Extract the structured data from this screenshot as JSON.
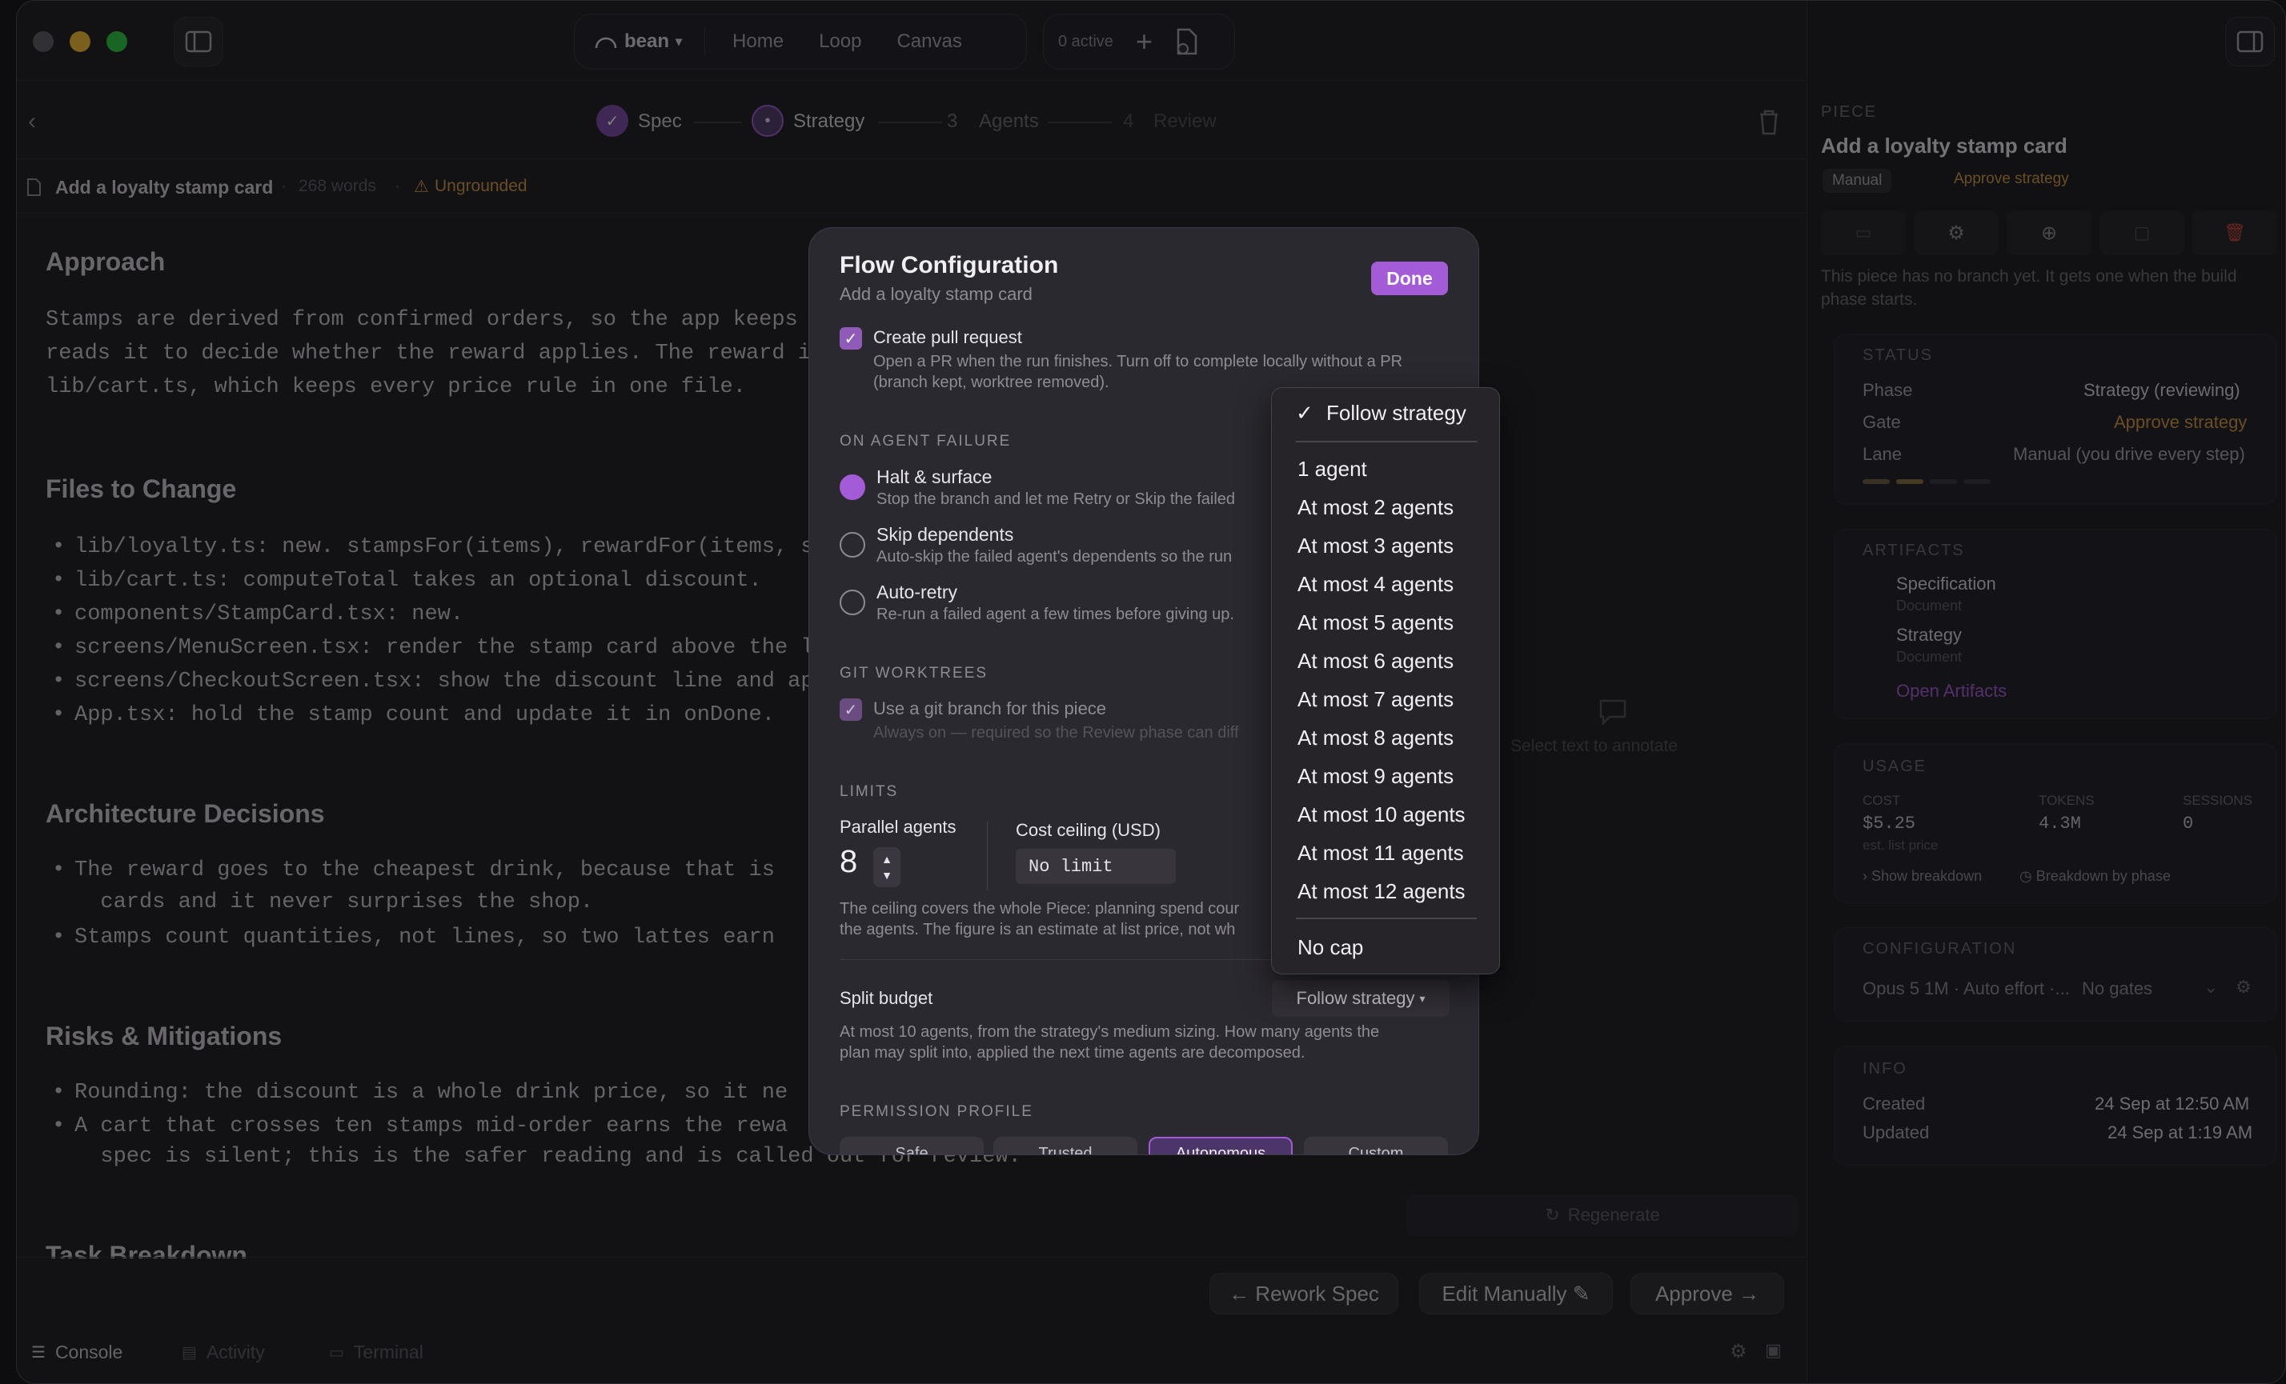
{
  "topbar": {
    "workspace": "bean",
    "nav": [
      "Home",
      "Loop",
      "Canvas"
    ],
    "active": "0 active"
  },
  "steps": [
    {
      "label": "Spec",
      "num": "✓"
    },
    {
      "label": "Strategy",
      "num": "•"
    },
    {
      "label": "Agents",
      "num": "3"
    },
    {
      "label": "Review",
      "num": "4"
    }
  ],
  "docbar": {
    "title": "Add a loyalty stamp card",
    "words": "268 words",
    "status": "Ungrounded"
  },
  "doc": {
    "approach": {
      "title": "Approach",
      "lines": [
        "Stamps are derived from confirmed orders, so the app keeps c",
        "reads it to decide whether the reward applies. The reward is",
        "lib/cart.ts, which keeps every price rule in one file."
      ]
    },
    "files": {
      "title": "Files to Change",
      "items": [
        "lib/loyalty.ts: new. stampsFor(items), rewardFor(items, sta",
        "lib/cart.ts: computeTotal takes an optional discount.",
        "components/StampCard.tsx: new.",
        "screens/MenuScreen.tsx: render the stamp card above the l",
        "screens/CheckoutScreen.tsx: show the discount line and ap",
        "App.tsx: hold the stamp count and update it in onDone."
      ]
    },
    "arch": {
      "title": "Architecture Decisions",
      "items": [
        "The reward goes to the cheapest drink, because that is",
        "  cards and it never surprises the shop.",
        "Stamps count quantities, not lines, so two lattes earn"
      ]
    },
    "risks": {
      "title": "Risks & Mitigations",
      "items": [
        "Rounding: the discount is a whole drink price, so it ne",
        "A cart that crosses ten stamps mid-order earns the rewa",
        "  spec is silent; this is the safer reading and is called out for review."
      ]
    },
    "next": "Task Breakdown"
  },
  "actions": {
    "rework": "← Rework Spec",
    "edit": "Edit Manually ✎",
    "approve": "Approve →",
    "regenerate": "Regenerate",
    "annotate": "Select text to annotate"
  },
  "bottomtabs": [
    "Console",
    "Activity",
    "Terminal"
  ],
  "panel": {
    "section": "PIECE",
    "title": "Add a loyalty stamp card",
    "lane_tag": "Manual",
    "gate_tag": "Approve strategy",
    "branch_note": "This piece has no branch yet. It gets one when the build phase starts.",
    "status": {
      "label": "STATUS",
      "rows": [
        [
          "Phase",
          "Strategy (reviewing)"
        ],
        [
          "Gate",
          "Approve strategy"
        ],
        [
          "Lane",
          "Manual (you drive every step)"
        ]
      ]
    },
    "artifacts": {
      "label": "ARTIFACTS",
      "items": [
        [
          "Specification",
          "Document"
        ],
        [
          "Strategy",
          "Document"
        ]
      ],
      "open": "Open Artifacts"
    },
    "usage": {
      "label": "USAGE",
      "cols": [
        [
          "COST",
          "$5.25"
        ],
        [
          "TOKENS",
          "4.3M"
        ],
        [
          "SESSIONS",
          "0"
        ]
      ],
      "note": "est. list price",
      "show": "Show breakdown",
      "byphase": "Breakdown by phase"
    },
    "config": {
      "label": "CONFIGURATION",
      "value": "Opus 5 1M · Auto effort ·...",
      "gates": "No gates"
    },
    "info": {
      "label": "INFO",
      "rows": [
        [
          "Created",
          "24 Sep at 12:50 AM"
        ],
        [
          "Updated",
          "24 Sep at 1:19 AM"
        ]
      ]
    }
  },
  "modal": {
    "title": "Flow Configuration",
    "subtitle": "Add a loyalty stamp card",
    "done": "Done",
    "pr": {
      "label": "Create pull request",
      "desc1": "Open a PR when the run finishes. Turn off to complete locally without a PR",
      "desc2": "(branch kept, worktree removed)."
    },
    "failure": {
      "label": "ON AGENT FAILURE",
      "options": [
        [
          "Halt & surface",
          "Stop the branch and let me Retry or Skip the failed"
        ],
        [
          "Skip dependents",
          "Auto-skip the failed agent's dependents so the run"
        ],
        [
          "Auto-retry",
          "Re-run a failed agent a few times before giving up."
        ]
      ]
    },
    "git": {
      "label": "GIT WORKTREES",
      "option": "Use a git branch for this piece",
      "desc": "Always on — required so the Review phase can diff"
    },
    "limits": {
      "label": "LIMITS",
      "parallel_label": "Parallel agents",
      "parallel_value": "8",
      "cost_label": "Cost ceiling (USD)",
      "cost_value": "No limit",
      "desc1": "The ceiling covers the whole Piece: planning spend cour",
      "desc2": "the agents. The figure is an estimate at list price, not wh"
    },
    "split": {
      "label": "Split budget",
      "value": "Follow strategy",
      "desc1": "At most 10 agents, from the strategy's medium sizing. How many agents the",
      "desc2": "plan may split into, applied the next time agents are decomposed."
    },
    "perm": {
      "label": "PERMISSION PROFILE",
      "options": [
        "Safe",
        "Trusted",
        "Autonomous",
        "Custom"
      ]
    }
  },
  "dropdown": {
    "selected": "Follow strategy",
    "items": [
      "1 agent",
      "At most 2 agents",
      "At most 3 agents",
      "At most 4 agents",
      "At most 5 agents",
      "At most 6 agents",
      "At most 7 agents",
      "At most 8 agents",
      "At most 9 agents",
      "At most 10 agents",
      "At most 11 agents",
      "At most 12 agents"
    ],
    "nocap": "No cap"
  },
  "colors": {
    "accent": "#a35bd6",
    "warn": "#d49a3e",
    "danger": "#d2483e"
  }
}
